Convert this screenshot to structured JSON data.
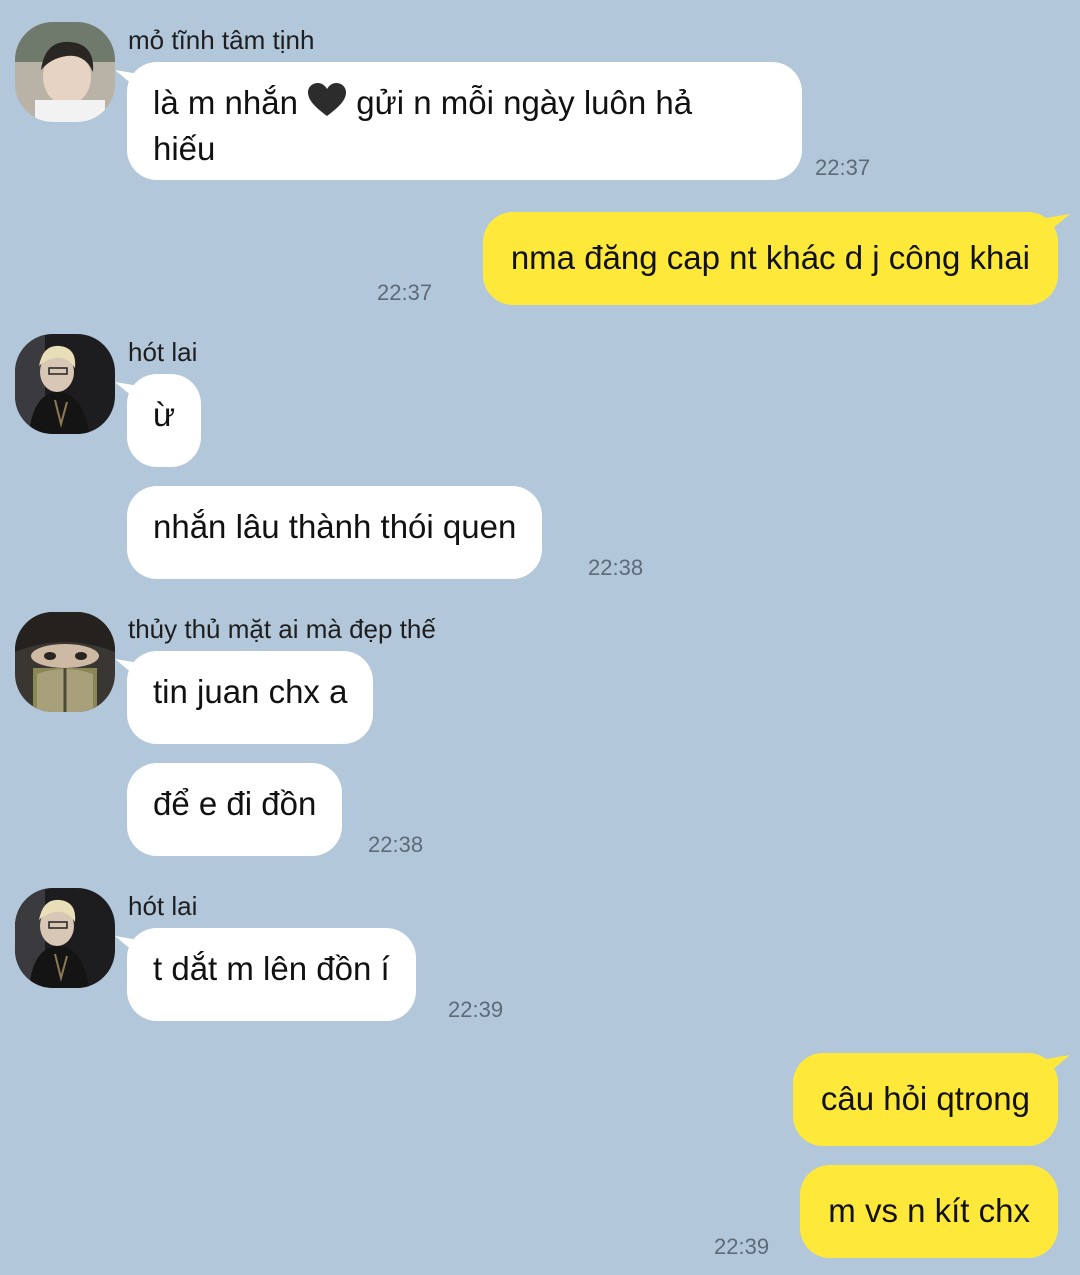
{
  "senders": {
    "s1": "mỏ tĩnh tâm tịnh",
    "s2": "hót lai",
    "s3": "thủy thủ mặt ai mà đẹp thế",
    "s4": "hót lai"
  },
  "messages": {
    "m1_before": "là m nhắn",
    "m1_after": "gửi n mỗi ngày luôn hả",
    "m1_line2": "hiếu",
    "m2": "nma đăng cap nt khác d j công khai",
    "m3": "ừ",
    "m4": "nhắn lâu thành thói quen",
    "m5": "tin juan chx a",
    "m6": "để e đi đồn",
    "m7": "t dắt m lên đồn í",
    "m8": "câu hỏi qtrong",
    "m9": "m vs n kít chx"
  },
  "times": {
    "t1": "22:37",
    "t2": "22:37",
    "t3": "22:38",
    "t4": "22:38",
    "t5": "22:39",
    "t6": "22:39"
  },
  "icons": {
    "m1_emoji": "black-heart-icon"
  },
  "colors": {
    "background": "#b2c7da",
    "incoming_bubble": "#ffffff",
    "outgoing_bubble": "#fee93b",
    "timestamp": "#5d6b78"
  }
}
